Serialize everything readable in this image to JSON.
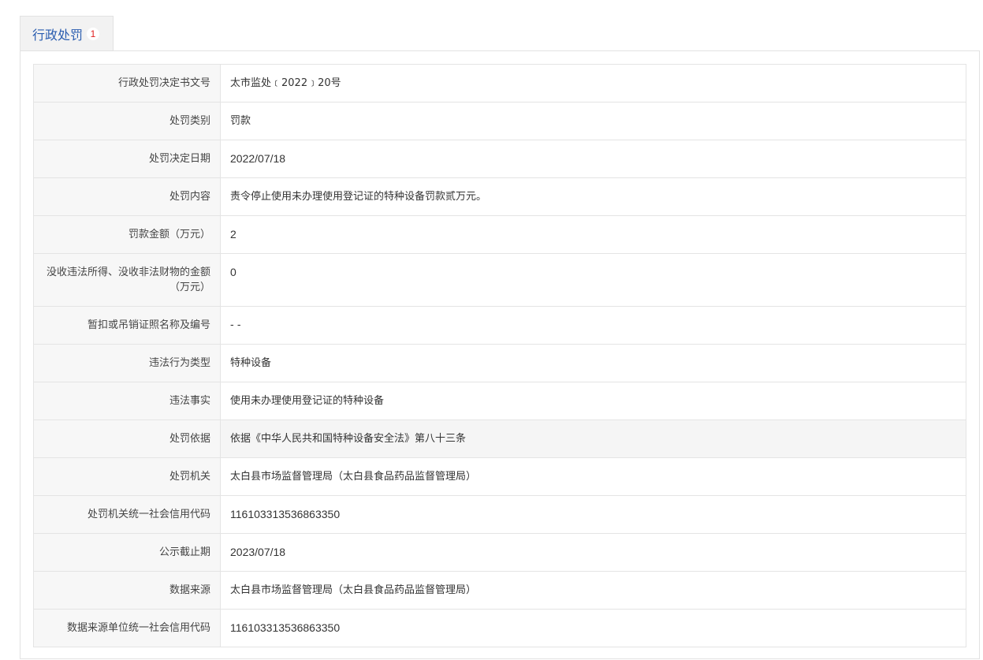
{
  "tab": {
    "label": "行政处罚",
    "count": "1"
  },
  "rows": [
    {
      "key": "行政处罚决定书文号",
      "value": "太市监处﹝2022﹞20号"
    },
    {
      "key": "处罚类别",
      "value": "罚款"
    },
    {
      "key": "处罚决定日期",
      "value": "2022/07/18"
    },
    {
      "key": "处罚内容",
      "value": "责令停止使用未办理使用登记证的特种设备罚款贰万元。"
    },
    {
      "key": "罚款金额（万元）",
      "value": "2"
    },
    {
      "key": "没收违法所得、没收非法财物的金额（万元）",
      "value": "0"
    },
    {
      "key": "暂扣或吊销证照名称及编号",
      "value": "- -"
    },
    {
      "key": "违法行为类型",
      "value": "特种设备"
    },
    {
      "key": "违法事实",
      "value": "使用未办理使用登记证的特种设备"
    },
    {
      "key": "处罚依据",
      "value": "依据《中华人民共和国特种设备安全法》第八十三条"
    },
    {
      "key": "处罚机关",
      "value": "太白县市场监督管理局（太白县食品药品监督管理局）"
    },
    {
      "key": "处罚机关统一社会信用代码",
      "value": "116103313536863350"
    },
    {
      "key": "公示截止期",
      "value": "2023/07/18"
    },
    {
      "key": "数据来源",
      "value": "太白县市场监督管理局（太白县食品药品监督管理局）"
    },
    {
      "key": "数据来源单位统一社会信用代码",
      "value": "116103313536863350"
    }
  ],
  "colors": {
    "accent": "#2a5db0",
    "badge": "#e02020",
    "border": "#e4e4e4",
    "label_bg": "#f7f7f7"
  }
}
